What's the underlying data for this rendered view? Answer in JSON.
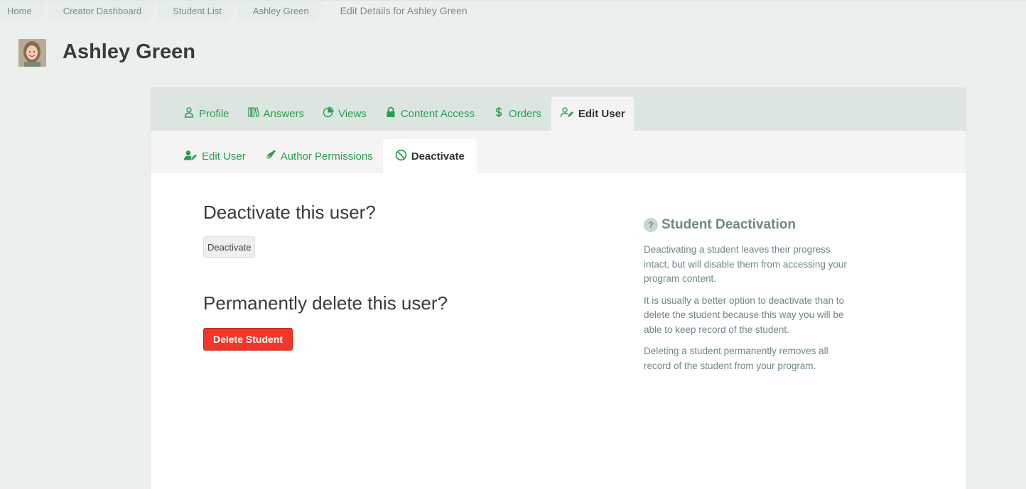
{
  "breadcrumb": {
    "items": [
      "Home",
      "Creator Dashboard",
      "Student List",
      "Ashley Green"
    ],
    "current": "Edit Details for Ashley Green"
  },
  "header": {
    "title": "Ashley Green"
  },
  "tabs": {
    "primary": [
      {
        "label": "Profile",
        "icon": "user-outline-icon"
      },
      {
        "label": "Answers",
        "icon": "books-icon"
      },
      {
        "label": "Views",
        "icon": "pie-chart-icon"
      },
      {
        "label": "Content Access",
        "icon": "lock-icon"
      },
      {
        "label": "Orders",
        "icon": "dollar-icon"
      },
      {
        "label": "Edit User",
        "icon": "user-edit-icon",
        "active": true
      }
    ],
    "secondary": [
      {
        "label": "Edit User",
        "icon": "user-edit-icon"
      },
      {
        "label": "Author Permissions",
        "icon": "pen-nib-icon"
      },
      {
        "label": "Deactivate",
        "icon": "ban-icon",
        "active": true
      }
    ]
  },
  "main": {
    "deactivate_heading": "Deactivate this user?",
    "deactivate_button": "Deactivate",
    "delete_heading": "Permanently delete this user?",
    "delete_button": "Delete Student"
  },
  "help": {
    "icon": "?",
    "title": "Student Deactivation",
    "paragraphs": [
      "Deactivating a student leaves their progress intact, but will disable them from accessing your program content.",
      "It is usually a better option to deactivate than to delete the student because this way you will be able to keep record of the student.",
      "Deleting a student permanently removes all record of the student from your program."
    ]
  },
  "colors": {
    "accent": "#2a9d4e",
    "danger": "#f2372a",
    "background": "#ebf0ee",
    "help_text": "#6f8a7c"
  }
}
